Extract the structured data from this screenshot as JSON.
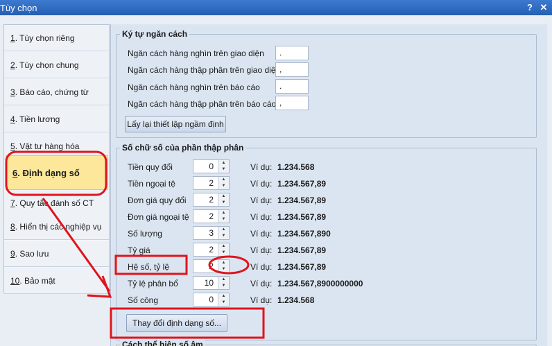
{
  "window": {
    "title": "Tùy chọn",
    "help_icon": "?",
    "close_icon": "✕"
  },
  "sidebar": {
    "items": [
      {
        "num": "1",
        "label": ". Tùy chọn riêng"
      },
      {
        "num": "2",
        "label": ". Tùy chọn chung"
      },
      {
        "num": "3",
        "label": ". Báo cáo, chứng từ"
      },
      {
        "num": "4",
        "label": ". Tiền lương"
      },
      {
        "num": "5",
        "label": ". Vật tư hàng hóa"
      },
      {
        "num": "6",
        "label": ". Định dạng số"
      },
      {
        "num": "7",
        "label": ". Quy tắc đánh số CT"
      },
      {
        "num": "8",
        "label": ". Hiển thị các nghiệp vụ"
      },
      {
        "num": "9",
        "label": ". Sao lưu"
      },
      {
        "num": "10",
        "label": ". Bảo mật"
      }
    ],
    "active_index": 5
  },
  "separators": {
    "title": "Ký tự ngăn cách",
    "rows": [
      {
        "label": "Ngăn cách hàng nghìn trên giao diện",
        "value": "."
      },
      {
        "label": "Ngăn cách hàng thập phân trên giao diện",
        "value": ","
      },
      {
        "label": "Ngăn cách hàng nghìn trên báo cáo",
        "value": "."
      },
      {
        "label": "Ngăn cách hàng thập phân trên báo cáo",
        "value": ","
      }
    ],
    "reset_button": "Lấy lại thiết lập ngầm định"
  },
  "decimals": {
    "title": "Số chữ số của phần thập phân",
    "example_label": "Ví dụ:",
    "rows": [
      {
        "label": "Tiền quy đổi",
        "value": "0",
        "example": "1.234.568"
      },
      {
        "label": "Tiền ngoại tệ",
        "value": "2",
        "example": "1.234.567,89"
      },
      {
        "label": "Đơn giá quy đổi",
        "value": "2",
        "example": "1.234.567,89"
      },
      {
        "label": "Đơn giá ngoại tệ",
        "value": "2",
        "example": "1.234.567,89"
      },
      {
        "label": "Số lượng",
        "value": "3",
        "example": "1.234.567,890"
      },
      {
        "label": "Tỷ giá",
        "value": "2",
        "example": "1.234.567,89"
      },
      {
        "label": "Hệ số, tỷ lệ",
        "value": "2",
        "example": "1.234.567,89"
      },
      {
        "label": "Tỷ lệ phân bổ",
        "value": "10",
        "example": "1.234.567,8900000000"
      },
      {
        "label": "Số công",
        "value": "0",
        "example": "1.234.568"
      }
    ],
    "change_button": "Thay đổi định dạng số..."
  },
  "negative": {
    "title": "Cách thể hiện số âm"
  },
  "colors": {
    "annotation": "#e0141b",
    "active_item": "#fde79a",
    "titlebar": "#2d6cc0"
  }
}
